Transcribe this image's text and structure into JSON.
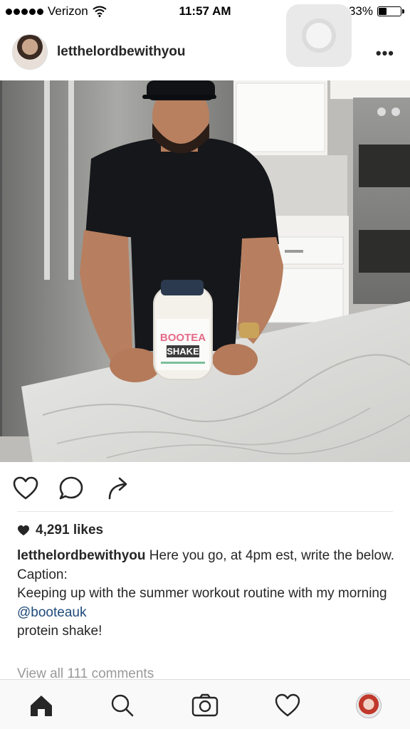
{
  "status_bar": {
    "carrier": "Verizon",
    "time": "11:57 AM",
    "battery_percent": "33%",
    "battery_level": 0.33
  },
  "post": {
    "username": "letthelordbewithyou",
    "product_label_line1": "BOOTEA",
    "product_label_line2": "SHAKE",
    "likes": "4,291 likes",
    "caption": {
      "username": "letthelordbewithyou",
      "line1": " Here you go, at 4pm est, write the below.",
      "line2": "Caption:",
      "line3_before": "Keeping up with the summer workout routine with my morning ",
      "mention": "@booteauk",
      "line4": "protein shake!"
    },
    "view_comments": "View all 111 comments"
  },
  "icons": {
    "like": "heart-outline-icon",
    "comment": "comment-bubble-icon",
    "share": "share-arrow-icon",
    "more": "more-dots-icon",
    "home": "home-icon",
    "search": "search-icon",
    "camera": "camera-icon",
    "activity": "heart-outline-icon"
  },
  "colors": {
    "mention": "#1e4a7a",
    "muted": "#999999",
    "text": "#262626"
  }
}
